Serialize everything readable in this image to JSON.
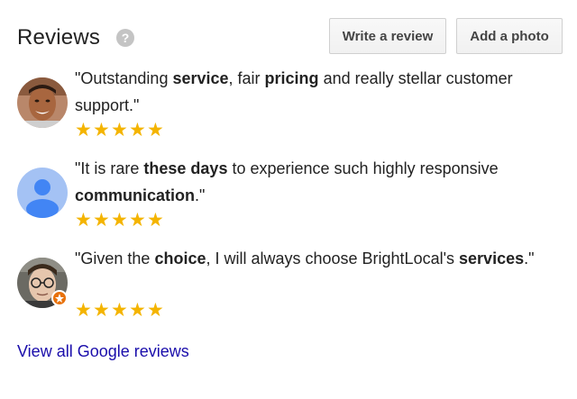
{
  "header": {
    "title": "Reviews",
    "help_icon": "?",
    "write_review_label": "Write a review",
    "add_photo_label": "Add a photo"
  },
  "reviews": [
    {
      "parts": [
        {
          "text": "\"Outstanding ",
          "bold": false
        },
        {
          "text": "service",
          "bold": true
        },
        {
          "text": ", fair ",
          "bold": false
        },
        {
          "text": "pricing",
          "bold": true
        },
        {
          "text": " and really stellar customer support.\"",
          "bold": false
        }
      ],
      "rating": 5,
      "avatar": "photo-man-smiling"
    },
    {
      "parts": [
        {
          "text": "\"It is rare ",
          "bold": false
        },
        {
          "text": "these days",
          "bold": true
        },
        {
          "text": " to experience such highly responsive ",
          "bold": false
        },
        {
          "text": "communication",
          "bold": true
        },
        {
          "text": ".\"",
          "bold": false
        }
      ],
      "rating": 5,
      "avatar": "default-user-icon"
    },
    {
      "parts": [
        {
          "text": "\"Given the ",
          "bold": false
        },
        {
          "text": "choice",
          "bold": true
        },
        {
          "text": ", I will always choose BrightLocal's ",
          "bold": false
        },
        {
          "text": "services",
          "bold": true
        },
        {
          "text": ".\"",
          "bold": false
        }
      ],
      "rating": 5,
      "avatar": "photo-man-glasses-local-guide"
    }
  ],
  "star_glyph": "★",
  "view_all_label": "View all Google reviews",
  "colors": {
    "star": "#f4b400",
    "link": "#1a0dab",
    "default_avatar_bg": "#a4c2f4",
    "default_avatar_fg": "#4285f4",
    "local_guide_badge": "#e8710a"
  }
}
